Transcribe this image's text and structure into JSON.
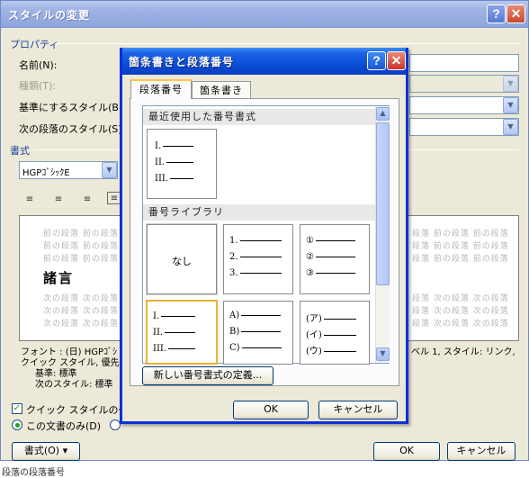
{
  "outer": {
    "title": "スタイルの変更",
    "properties_heading": "プロパティ",
    "name_label": "名前(N):",
    "type_label": "種類(T):",
    "base_style_label": "基準にするスタイル(B):",
    "next_style_label": "次の段落のスタイル(S):",
    "format_heading": "書式",
    "font_value": "HGPｺﾞｼｯｸE",
    "sample_before": "前の段落 前の段落 前の段落",
    "sample_before_right": "段落 前の段落 前の段落",
    "sample_main": "諸言",
    "sample_after": "次の段落 次の段落 次の段落",
    "sample_after_right": "段落 次の段落 次の段落",
    "desc_line1": "フォント : (日) HGPｺﾞｼ",
    "desc_line1_right": "ベル 1, スタイル: リンク,",
    "desc_line2": "クイック スタイル, 優先度",
    "desc_line3": "基準: 標準",
    "desc_line4": "次のスタイル: 標準",
    "quick_style_label": "クイック スタイルの一覧",
    "this_doc_only_label": "この文書のみ(D)",
    "format_button": "書式(O) ▾",
    "ok_button": "OK",
    "cancel_button": "キャンセル",
    "bottom_cut_text": "段落の段落番号"
  },
  "modal": {
    "title": "箇条書きと段落番号",
    "tab_numbering": "段落番号",
    "tab_bullets": "箇条書き",
    "recent_heading": "最近使用した番号書式",
    "library_heading": "番号ライブラリ",
    "none_label": "なし",
    "recent_format": [
      "I.",
      "II.",
      "III."
    ],
    "library_formats": [
      [
        "1.",
        "2.",
        "3."
      ],
      [
        "①",
        "②",
        "③"
      ],
      [
        "I.",
        "II.",
        "III."
      ],
      [
        "A)",
        "B)",
        "C)"
      ],
      [
        "(ア)",
        "(イ)",
        "(ウ)"
      ]
    ],
    "define_button": "新しい番号書式の定義...",
    "ok_button": "OK",
    "cancel_button": "キャンセル"
  },
  "icons": {
    "help": "?",
    "close": "✕",
    "scroll_up": "▲",
    "scroll_down": "▼",
    "dropdown": "▼"
  }
}
